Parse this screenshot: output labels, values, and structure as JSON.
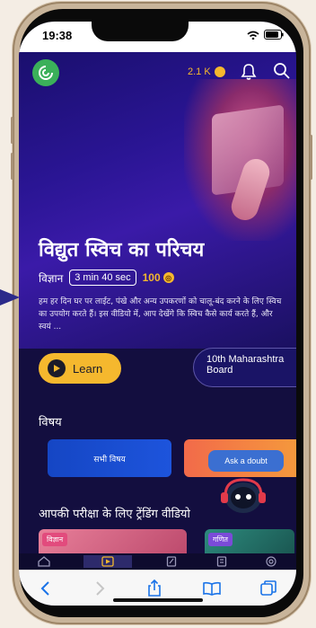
{
  "status_bar": {
    "time": "19:38"
  },
  "header": {
    "coins": "2.1 K"
  },
  "hero": {
    "title": "विद्युत स्विच का परिचय",
    "subject": "विज्ञान",
    "duration": "3 min 40 sec",
    "points": "100",
    "description": "हम हर दिन घर पर लाईट, पंखे और अन्य उपकरणों को चालू-बंद करने के लिए स्विच का उपयोग करते हैं। इस वीडियो में, आप देखेंगे कि स्विच कैसे कार्य करते हैं, और स्वयं ...",
    "learn_label": "Learn",
    "board_line1": "10th Maharashtra",
    "board_line2": "Board"
  },
  "subjects_section": {
    "title": "विषय",
    "items": [
      "सभी विषय"
    ]
  },
  "doubt": {
    "label": "Ask a doubt"
  },
  "trending": {
    "title": "आपकी परीक्षा के लिए ट्रेंडिंग वीडियो",
    "cards": [
      {
        "tag": "विज्ञान"
      },
      {
        "tag": "गणित"
      }
    ]
  },
  "icons": {
    "logo": "app-logo-icon",
    "bell": "bell-icon",
    "search": "search-icon",
    "coin": "coin-icon",
    "play": "play-icon",
    "tabs": [
      "home-icon",
      "video-icon",
      "notes-icon",
      "test-icon",
      "target-icon"
    ],
    "browser": [
      "back-icon",
      "forward-icon",
      "share-icon",
      "bookmarks-icon",
      "tabs-icon"
    ]
  },
  "colors": {
    "accent": "#f5b82e",
    "background": "#130e3f",
    "logo": "#3bb05a"
  }
}
